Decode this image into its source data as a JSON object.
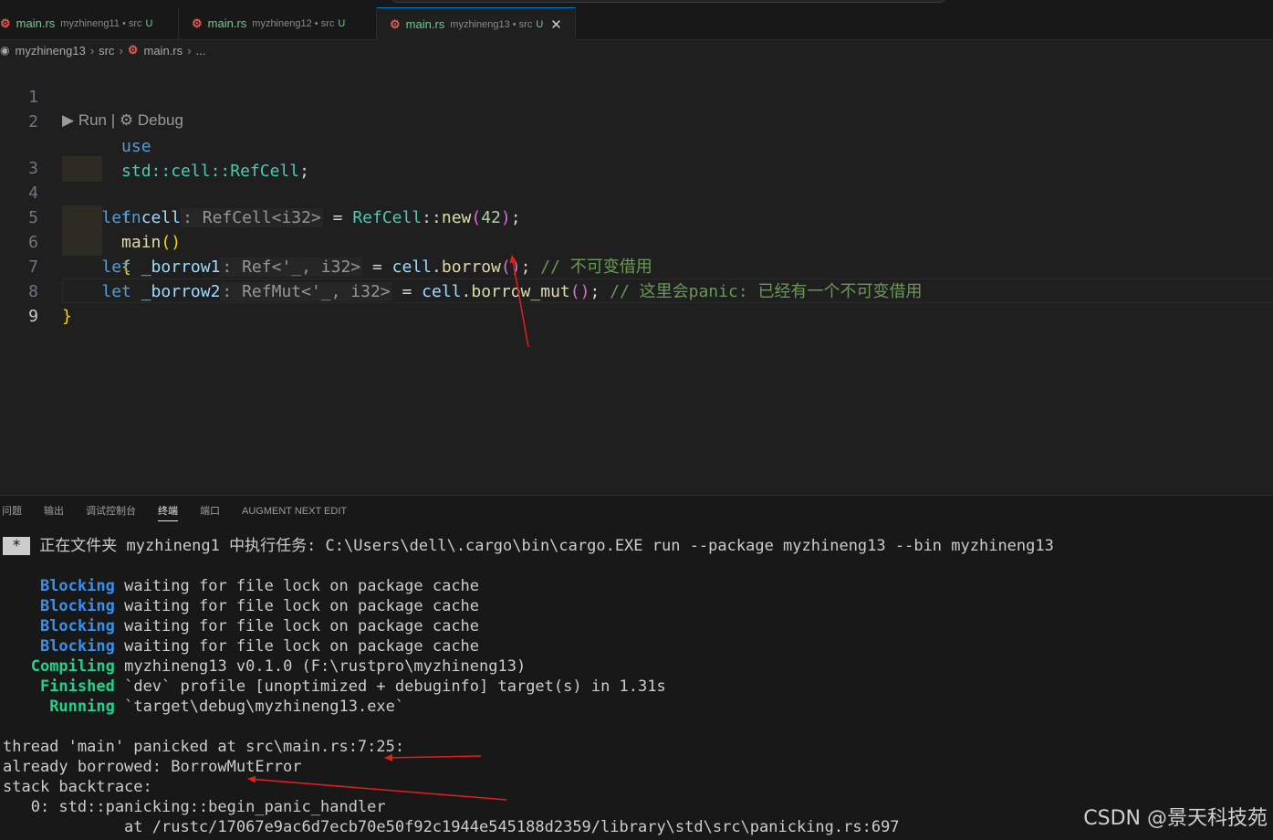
{
  "tabs": [
    {
      "file": "main.rs",
      "path": "myzhineng11 • src",
      "mod": "U",
      "active": false
    },
    {
      "file": "main.rs",
      "path": "myzhineng12 • src",
      "mod": "U",
      "active": false
    },
    {
      "file": "main.rs",
      "path": "myzhineng13 • src",
      "mod": "U",
      "active": true,
      "close": "✕"
    }
  ],
  "breadcrumb": {
    "project": "myzhineng13",
    "folder": "src",
    "file": "main.rs",
    "more": "..."
  },
  "editor": {
    "line_numbers": [
      "1",
      "2",
      "3",
      "4",
      "5",
      "6",
      "7",
      "8",
      "9"
    ],
    "codelens": {
      "run": "Run",
      "separator": "|",
      "debug": "Debug"
    },
    "line1": {
      "kw": "use",
      "path": "std::cell::",
      "type": "RefCell",
      "end": ";"
    },
    "line3": {
      "kw": "fn",
      "name": "main",
      "parens": "()",
      "brace": "{"
    },
    "line4": {
      "kw": "let",
      "var": "cell",
      "hint": ": RefCell<i32>",
      "eq": " = ",
      "type": "RefCell",
      "sep": "::",
      "fn": "new",
      "open": "(",
      "num": "42",
      "close": ")",
      "end": ";"
    },
    "line6": {
      "kw": "let",
      "var": "_borrow1",
      "hint": ": Ref<'_, i32>",
      "eq": " = ",
      "recv": "cell",
      "dot": ".",
      "fn": "borrow",
      "call": "()",
      "end": "; ",
      "comment": "// 不可变借用"
    },
    "line7": {
      "kw": "let",
      "var": "_borrow2",
      "hint": ": RefMut<'_, i32>",
      "eq": " = ",
      "recv": "cell",
      "dot": ".",
      "fn": "borrow_mut",
      "call": "()",
      "end": "; ",
      "comment": "// 这里会panic: 已经有一个不可变借用"
    },
    "line8": {
      "brace": "}"
    }
  },
  "panel": {
    "tabs": [
      "问题",
      "输出",
      "调试控制台",
      "终端",
      "端口",
      "AUGMENT NEXT EDIT"
    ],
    "active_tab": "终端"
  },
  "terminal": {
    "task_marker": "*",
    "task_line": "正在文件夹 myzhineng1 中执行任务: C:\\Users\\dell\\.cargo\\bin\\cargo.EXE run --package myzhineng13 --bin myzhineng13",
    "status_lines": [
      {
        "status": "Blocking",
        "text": "waiting for file lock on package cache",
        "color": "blue"
      },
      {
        "status": "Blocking",
        "text": "waiting for file lock on package cache",
        "color": "blue"
      },
      {
        "status": "Blocking",
        "text": "waiting for file lock on package cache",
        "color": "blue"
      },
      {
        "status": "Blocking",
        "text": "waiting for file lock on package cache",
        "color": "blue"
      },
      {
        "status": "Compiling",
        "text": "myzhineng13 v0.1.0 (F:\\rustpro\\myzhineng13)",
        "color": "green"
      },
      {
        "status": "Finished",
        "text": "`dev` profile [unoptimized + debuginfo] target(s) in 1.31s",
        "color": "green"
      },
      {
        "status": "Running",
        "text": "`target\\debug\\myzhineng13.exe`",
        "color": "green"
      }
    ],
    "panic_lines": [
      "thread 'main' panicked at src\\main.rs:7:25:",
      "already borrowed: BorrowMutError",
      "stack backtrace:",
      "   0: std::panicking::begin_panic_handler",
      "             at /rustc/17067e9ac6d7ecb70e50f92c1944e545188d2359/library\\std\\src\\panicking.rs:697"
    ]
  },
  "watermark": "CSDN @景天科技苑",
  "colors": {
    "annotation_arrow": "#e0201c",
    "tab_accent": "#0078d4"
  }
}
